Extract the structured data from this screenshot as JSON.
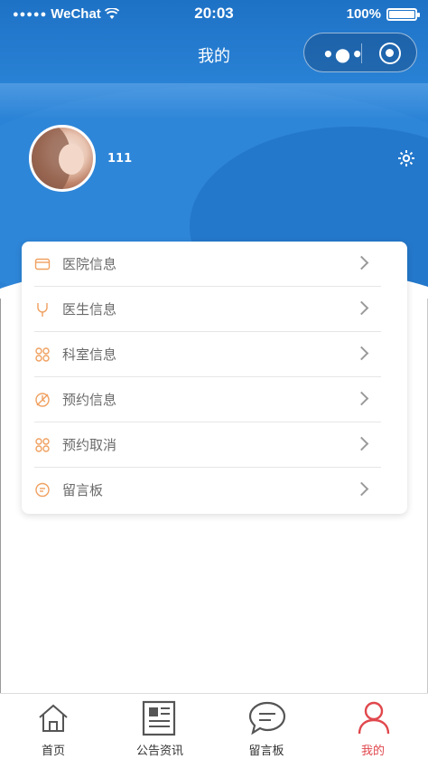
{
  "status_bar": {
    "signal_dots": "●●●●●",
    "carrier": "WeChat",
    "time": "20:03",
    "battery": "100%"
  },
  "nav": {
    "title": "我的"
  },
  "profile": {
    "username": "111"
  },
  "menu": [
    {
      "label": "医院信息",
      "icon": "card-icon"
    },
    {
      "label": "医生信息",
      "icon": "doctor-icon"
    },
    {
      "label": "科室信息",
      "icon": "grid-icon"
    },
    {
      "label": "预约信息",
      "icon": "appointment-icon"
    },
    {
      "label": "预约取消",
      "icon": "grid-icon"
    },
    {
      "label": "留言板",
      "icon": "message-icon"
    }
  ],
  "tabbar": [
    {
      "label": "首页",
      "icon": "home-icon",
      "active": false
    },
    {
      "label": "公告资讯",
      "icon": "news-icon",
      "active": false
    },
    {
      "label": "留言板",
      "icon": "chat-icon",
      "active": false
    },
    {
      "label": "我的",
      "icon": "user-icon",
      "active": true
    }
  ],
  "colors": {
    "primary": "#2b82d5",
    "icon_orange": "#f0a060",
    "active_tab": "#e0484d"
  }
}
